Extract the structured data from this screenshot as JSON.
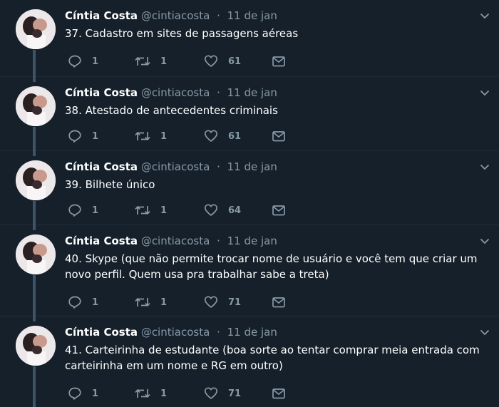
{
  "tweets": [
    {
      "name": "Cíntia Costa",
      "handle": "@cintiacosta",
      "dot": "·",
      "date": "11 de jan",
      "text": "37. Cadastro em sites de passagens aéreas",
      "replies": "1",
      "retweets": "1",
      "likes": "61"
    },
    {
      "name": "Cíntia Costa",
      "handle": "@cintiacosta",
      "dot": "·",
      "date": "11 de jan",
      "text": "38. Atestado de antecedentes criminais",
      "replies": "1",
      "retweets": "1",
      "likes": "61"
    },
    {
      "name": "Cíntia Costa",
      "handle": "@cintiacosta",
      "dot": "·",
      "date": "11 de jan",
      "text": "39. Bilhete único",
      "replies": "1",
      "retweets": "1",
      "likes": "64"
    },
    {
      "name": "Cíntia Costa",
      "handle": "@cintiacosta",
      "dot": "·",
      "date": "11 de jan",
      "text": "40. Skype (que não permite trocar nome de usuário e você tem que criar um novo perfil. Quem usa pra trabalhar sabe a treta)",
      "replies": "1",
      "retweets": "1",
      "likes": "71"
    },
    {
      "name": "Cíntia Costa",
      "handle": "@cintiacosta",
      "dot": "·",
      "date": "11 de jan",
      "text": "41. Carteirinha de estudante (boa sorte ao tentar comprar meia entrada com carteirinha em um nome e RG em outro)",
      "replies": "1",
      "retweets": "1",
      "likes": "71"
    }
  ],
  "icons": {
    "reply": "reply-icon",
    "retweet": "retweet-icon",
    "like": "heart-icon",
    "dm": "envelope-icon",
    "menu": "chevron-down-icon"
  },
  "colors": {
    "background": "#15202b",
    "name": "#ffffff",
    "secondary_text": "#8899a6",
    "thread_line": "#3d5466",
    "divider": "#1f2c38"
  }
}
